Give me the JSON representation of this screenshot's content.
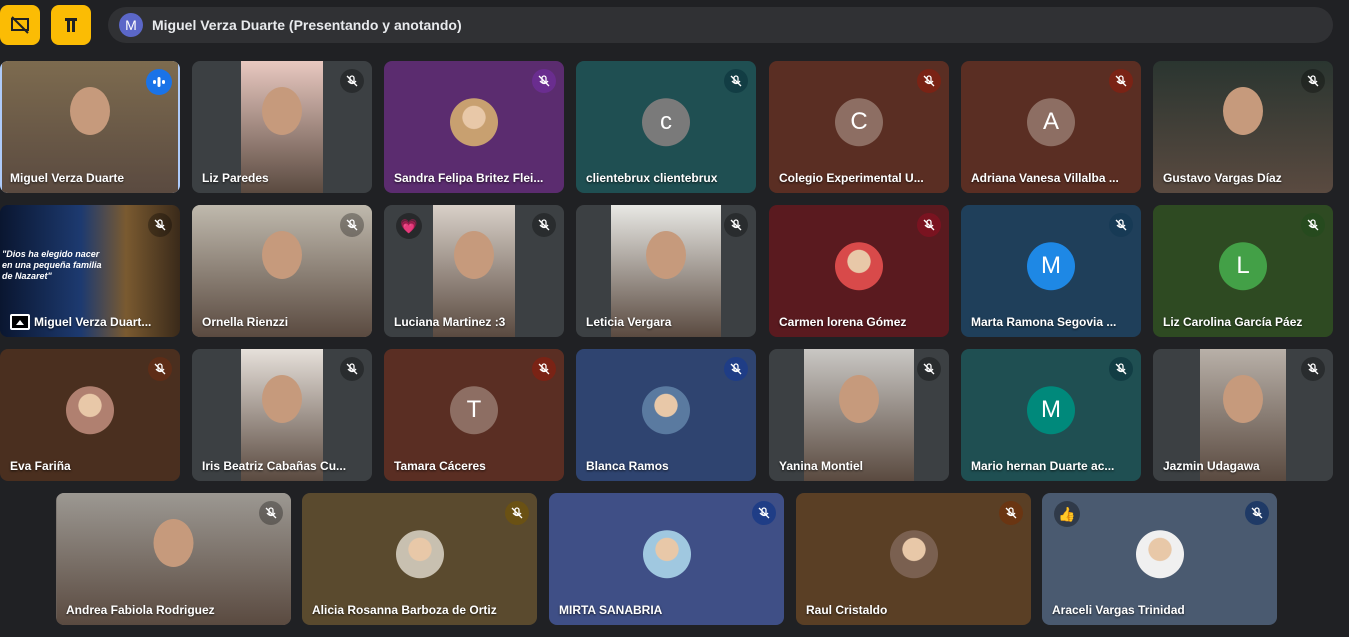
{
  "presenter_bar": {
    "avatar_letter": "M",
    "text": "Miguel Verza Duarte (Presentando y anotando)"
  },
  "participants": [
    {
      "name": "Miguel Verza Duarte",
      "type": "video",
      "bg": "#6b5a42"
    },
    {
      "name": "Liz Paredes",
      "type": "video",
      "bg": "#3c4043"
    },
    {
      "name": "Sandra Felipa Britez Flei...",
      "type": "photo",
      "bg": "#5b2c6f",
      "mic_bg": "#6a2d8f"
    },
    {
      "name": "clientebrux clientebrux",
      "type": "letter",
      "letter": "c",
      "bg": "#1f4f52",
      "avatar_bg": "#7a7a7a",
      "mic_bg": "#123d44"
    },
    {
      "name": "Colegio Experimental U...",
      "type": "letter",
      "letter": "C",
      "bg": "#5a2e23",
      "avatar_bg": "#8d6e63",
      "mic_bg": "#7a2315"
    },
    {
      "name": "Adriana Vanesa Villalba ...",
      "type": "letter",
      "letter": "A",
      "bg": "#5a2e23",
      "avatar_bg": "#8d6e63",
      "mic_bg": "#7a2315"
    },
    {
      "name": "Gustavo Vargas Díaz",
      "type": "video",
      "bg": "#1a1f24"
    },
    {
      "name": "Miguel Verza Duart...",
      "type": "presentation",
      "bg": "#0b1838",
      "slide_text": "\"Dios ha elegido nacer\nen una pequeña familia\nde Nazaret\""
    },
    {
      "name": "Ornella Rienzzi",
      "type": "video",
      "bg": "#6f6a5f"
    },
    {
      "name": "Luciana Martinez :3",
      "type": "video",
      "bg": "#3c4043",
      "reaction": "💗"
    },
    {
      "name": "Leticia Vergara",
      "type": "video",
      "bg": "#3c4043"
    },
    {
      "name": "Carmen lorena Gómez",
      "type": "photo",
      "bg": "#5a1a1f",
      "mic_bg": "#7a1320"
    },
    {
      "name": "Marta Ramona Segovia ...",
      "type": "letter",
      "letter": "M",
      "bg": "#1f3f5a",
      "avatar_bg": "#1e88e5",
      "mic_bg": "#173a55"
    },
    {
      "name": "Liz Carolina García Páez",
      "type": "letter",
      "letter": "L",
      "bg": "#2e4a22",
      "avatar_bg": "#43a047",
      "mic_bg": "#264a1e"
    },
    {
      "name": "Eva Fariña",
      "type": "photo",
      "bg": "#4a2f1f",
      "mic_bg": "#5e2d17"
    },
    {
      "name": "Iris Beatriz Cabañas Cu...",
      "type": "video",
      "bg": "#3c4043"
    },
    {
      "name": "Tamara Cáceres",
      "type": "letter",
      "letter": "T",
      "bg": "#5a2e23",
      "avatar_bg": "#8d6e63",
      "mic_bg": "#7a2315"
    },
    {
      "name": "Blanca Ramos",
      "type": "photo",
      "bg": "#2f4470",
      "mic_bg": "#1f3d86"
    },
    {
      "name": "Yanina Montiel",
      "type": "video",
      "bg": "#3c4043"
    },
    {
      "name": "Mario hernan Duarte ac...",
      "type": "letter",
      "letter": "M",
      "bg": "#1f4f52",
      "avatar_bg": "#00897b",
      "mic_bg": "#123d44"
    },
    {
      "name": "Jazmin Udagawa",
      "type": "video",
      "bg": "#3c4043"
    },
    {
      "name": "Andrea Fabiola Rodriguez",
      "type": "video",
      "bg": "#6b6560"
    },
    {
      "name": "Alicia Rosanna Barboza de Ortiz",
      "type": "photo",
      "bg": "#5a4a2e",
      "mic_bg": "#6a5114"
    },
    {
      "name": "MIRTA SANABRIA",
      "type": "photo",
      "bg": "#3f4f86",
      "mic_bg": "#1f3d86"
    },
    {
      "name": "Raul Cristaldo",
      "type": "photo",
      "bg": "#5a3f25",
      "mic_bg": "#6a3512"
    },
    {
      "name": "Araceli Vargas Trinidad",
      "type": "photo",
      "bg": "#4a5a70",
      "mic_bg": "#1f3a66",
      "reaction": "👍"
    }
  ]
}
